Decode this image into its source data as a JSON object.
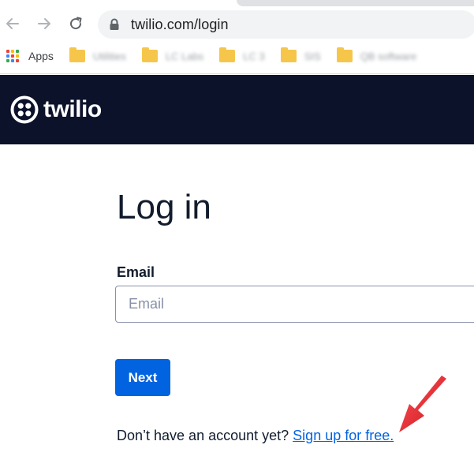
{
  "browser": {
    "url": "twilio.com/login",
    "apps_label": "Apps",
    "bookmarks": [
      {
        "label": "Utilities"
      },
      {
        "label": "LC Labs"
      },
      {
        "label": "LC 3"
      },
      {
        "label": "SIS"
      },
      {
        "label": "QB software"
      }
    ]
  },
  "header": {
    "logo_text": "twilio"
  },
  "login": {
    "title": "Log in",
    "email_label": "Email",
    "email_placeholder": "Email",
    "email_value": "",
    "next_label": "Next",
    "signup_prompt": "Don’t have an account yet?",
    "signup_link": "Sign up for free."
  },
  "colors": {
    "header_bg": "#0d122b",
    "primary": "#0263e0",
    "annotation_arrow": "#e8141c"
  }
}
